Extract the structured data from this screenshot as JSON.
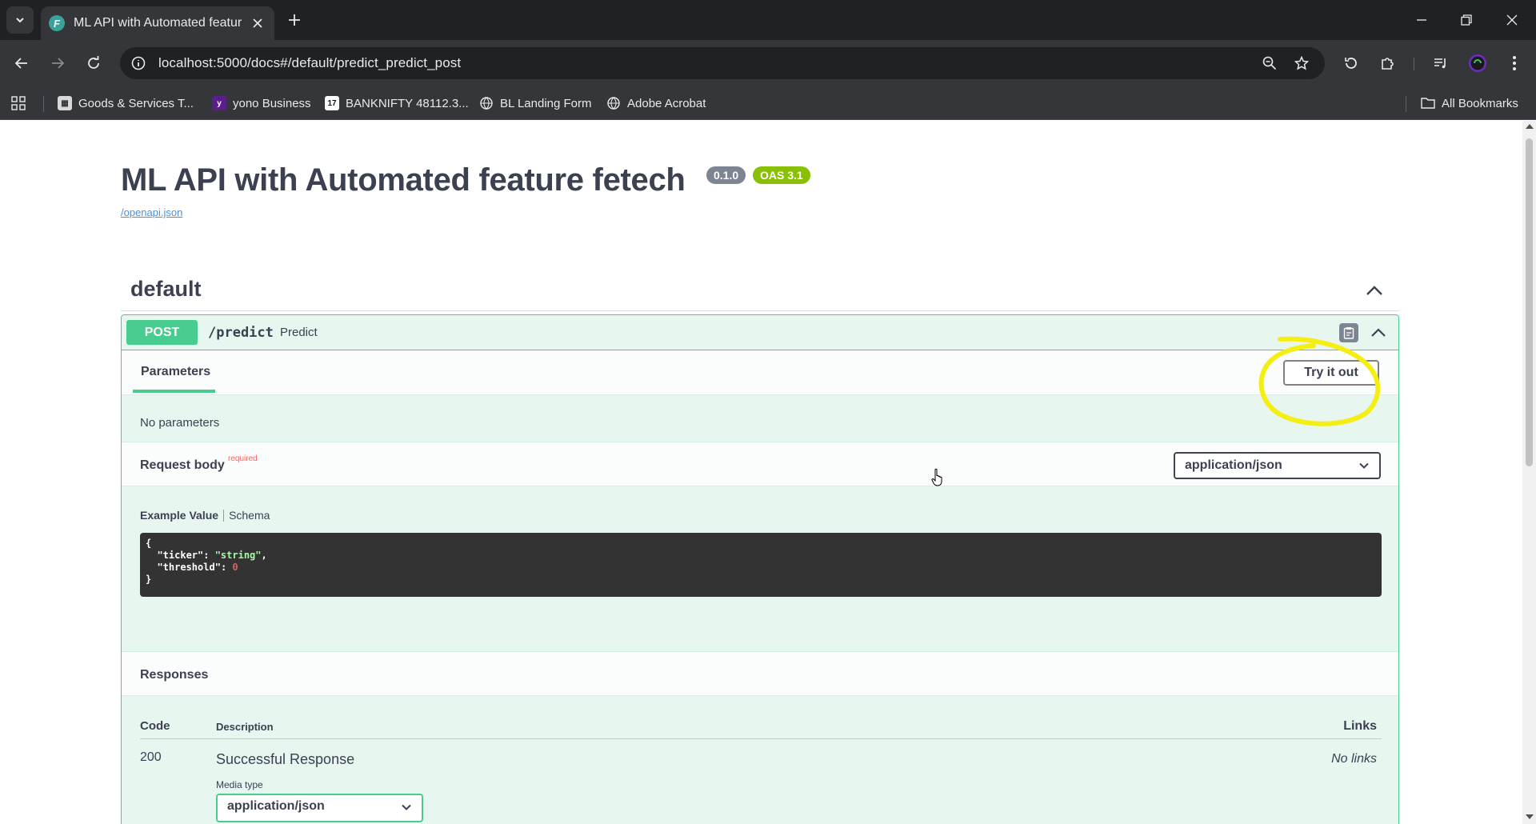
{
  "browser": {
    "tab_title": "ML API with Automated feature fetech",
    "url": "localhost:5000/docs#/default/predict_predict_post",
    "bookmarks": [
      {
        "label": "Goods & Services T...",
        "icon": "gst-icon"
      },
      {
        "label": "yono Business",
        "icon": "yono-icon"
      },
      {
        "label": "BANKNIFTY 48112.3...",
        "icon": "tradingview-icon"
      },
      {
        "label": "BL Landing Form",
        "icon": "globe-icon"
      },
      {
        "label": "Adobe Acrobat",
        "icon": "globe-icon"
      }
    ],
    "all_bookmarks": "All Bookmarks"
  },
  "api": {
    "title": "ML API with Automated feature fetech",
    "version": "0.1.0",
    "oas": "OAS 3.1",
    "openapi_link": "/openapi.json"
  },
  "section": {
    "title": "default"
  },
  "operation": {
    "method": "POST",
    "path": "/predict",
    "summary": "Predict",
    "parameters_tab": "Parameters",
    "try_it_out": "Try it out",
    "no_parameters": "No parameters",
    "request_body_label": "Request body",
    "required_label": "required",
    "content_type": "application/json",
    "example_value_tab": "Example Value",
    "schema_tab": "Schema",
    "example": {
      "ticker_key": "\"ticker\"",
      "ticker_value": "\"string\"",
      "threshold_key": "\"threshold\"",
      "threshold_value": "0"
    }
  },
  "responses": {
    "title": "Responses",
    "headers": {
      "code": "Code",
      "description": "Description",
      "links": "Links"
    },
    "rows": [
      {
        "code": "200",
        "description": "Successful Response",
        "links": "No links",
        "media_type_label": "Media type",
        "media_type": "application/json"
      }
    ]
  },
  "colors": {
    "post": "#49cc90",
    "post_bg": "#e8f6f0",
    "highlight": "#f4ee12",
    "version_badge": "#7d8492",
    "oas_badge": "#89bf04"
  }
}
